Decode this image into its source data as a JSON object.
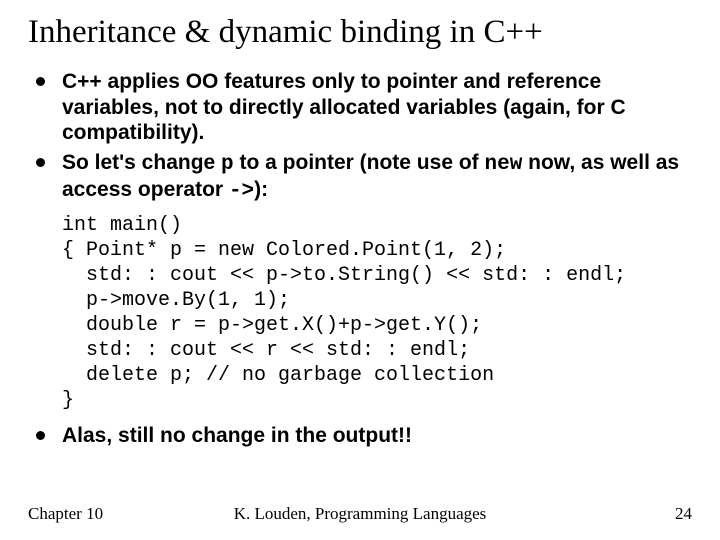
{
  "title": "Inheritance & dynamic binding in C++",
  "bullets": {
    "b1": "C++ applies OO features only to pointer and reference variables, not to directly allocated variables (again, for C compatibility).",
    "b2a": "So let's change ",
    "b2_code1": "p",
    "b2b": " to a pointer (note use of ",
    "b2_code2": "new",
    "b2c": " now, as well as access operator ",
    "b2_code3": "->",
    "b2d": "):",
    "b3": "Alas, still no change in the output!!"
  },
  "code": "int main()\n{ Point* p = new Colored.Point(1, 2);\n  std: : cout << p->to.String() << std: : endl;\n  p->move.By(1, 1);\n  double r = p->get.X()+p->get.Y();\n  std: : cout << r << std: : endl;\n  delete p; // no garbage collection\n}",
  "footer": {
    "left": "Chapter 10",
    "center": "K. Louden, Programming Languages",
    "right": "24"
  }
}
